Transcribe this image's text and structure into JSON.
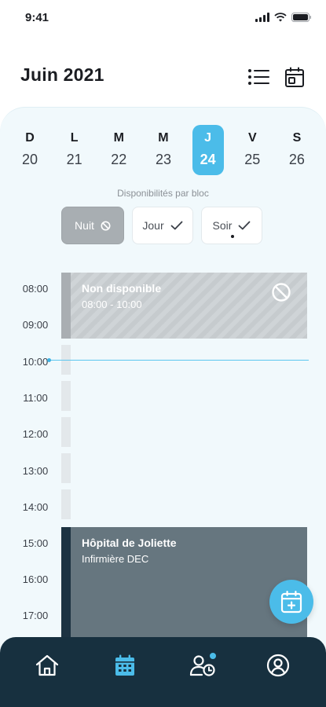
{
  "status": {
    "time": "9:41"
  },
  "header": {
    "title": "Juin 2021",
    "list_icon": "list-icon",
    "calendar_icon": "calendar-day-icon"
  },
  "week": [
    {
      "letter": "D",
      "num": "20",
      "active": false
    },
    {
      "letter": "L",
      "num": "21",
      "active": false
    },
    {
      "letter": "M",
      "num": "22",
      "active": false
    },
    {
      "letter": "M",
      "num": "23",
      "active": false
    },
    {
      "letter": "J",
      "num": "24",
      "active": true
    },
    {
      "letter": "V",
      "num": "25",
      "active": false
    },
    {
      "letter": "S",
      "num": "26",
      "active": false
    }
  ],
  "availability": {
    "label": "Disponibilités par bloc",
    "blocks": [
      {
        "label": "Nuit",
        "state": "unavailable",
        "icon": "block-icon"
      },
      {
        "label": "Jour",
        "state": "available",
        "icon": "check-icon"
      },
      {
        "label": "Soir",
        "state": "available",
        "icon": "check-icon"
      }
    ]
  },
  "timeline": {
    "hours": [
      "08:00",
      "09:00",
      "10:00",
      "11:00",
      "12:00",
      "13:00",
      "14:00",
      "15:00",
      "16:00",
      "17:00"
    ],
    "current_time": "10:00"
  },
  "events": {
    "unavailable": {
      "title": "Non disponible",
      "time": "08:00 - 10:00",
      "icon": "block-icon"
    },
    "shift": {
      "title": "Hôpital de Joliette",
      "subtitle": "Infirmière DEC"
    }
  },
  "fab": {
    "icon": "calendar-add-icon"
  },
  "nav": {
    "items": [
      {
        "name": "home",
        "icon": "home-icon",
        "active": false
      },
      {
        "name": "calendar",
        "icon": "calendar-icon",
        "active": true
      },
      {
        "name": "availability",
        "icon": "user-clock-icon",
        "active": false,
        "badge": true
      },
      {
        "name": "profile",
        "icon": "profile-icon",
        "active": false
      }
    ]
  },
  "colors": {
    "accent": "#4bbce9",
    "panel_bg": "#f1f9fc",
    "nav_bg": "#17303f",
    "shift_bg": "#66767f",
    "unavailable_bg": "#c9ced1"
  }
}
